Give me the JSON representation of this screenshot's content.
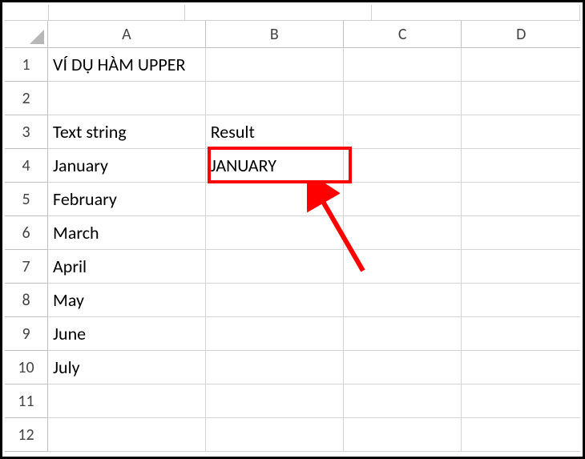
{
  "columns": [
    "A",
    "B",
    "C",
    "D"
  ],
  "rowNumbers": [
    "1",
    "2",
    "3",
    "4",
    "5",
    "6",
    "7",
    "8",
    "9",
    "10",
    "11",
    "12"
  ],
  "cells": {
    "r1": {
      "A": "VÍ DỤ HÀM UPPER",
      "B": "",
      "C": "",
      "D": ""
    },
    "r2": {
      "A": "",
      "B": "",
      "C": "",
      "D": ""
    },
    "r3": {
      "A": "Text string",
      "B": "Result",
      "C": "",
      "D": ""
    },
    "r4": {
      "A": "January",
      "B": "JANUARY",
      "C": "",
      "D": ""
    },
    "r5": {
      "A": "February",
      "B": "",
      "C": "",
      "D": ""
    },
    "r6": {
      "A": "March",
      "B": "",
      "C": "",
      "D": ""
    },
    "r7": {
      "A": "April",
      "B": "",
      "C": "",
      "D": ""
    },
    "r8": {
      "A": "May",
      "B": "",
      "C": "",
      "D": ""
    },
    "r9": {
      "A": "June",
      "B": "",
      "C": "",
      "D": ""
    },
    "r10": {
      "A": "July",
      "B": "",
      "C": "",
      "D": ""
    },
    "r11": {
      "A": "",
      "B": "",
      "C": "",
      "D": ""
    },
    "r12": {
      "A": "",
      "B": "",
      "C": "",
      "D": ""
    }
  },
  "annotation": {
    "highlighted_cell": "B4",
    "highlight_color": "#ff0000",
    "arrow_color": "#ff0000"
  }
}
